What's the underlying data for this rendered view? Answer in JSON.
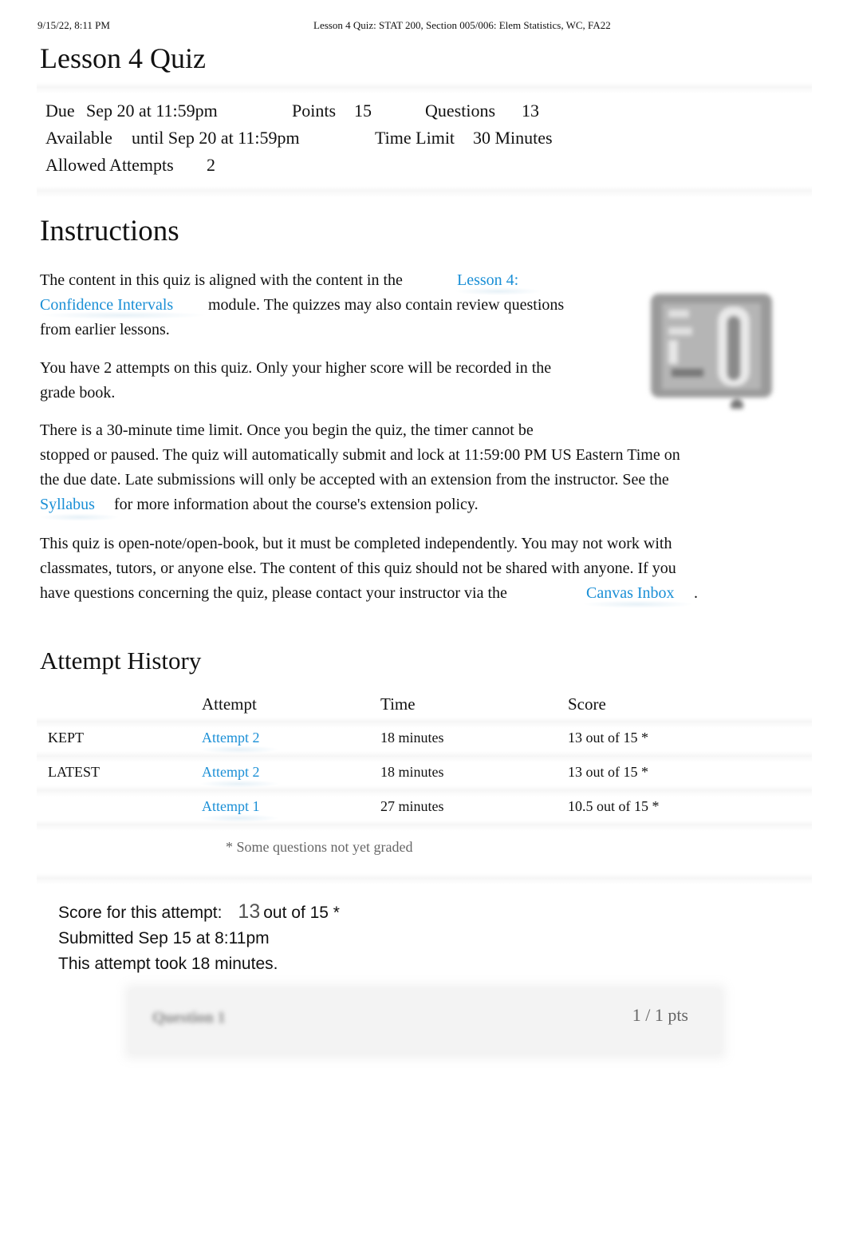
{
  "print_header": {
    "datetime": "9/15/22, 8:11 PM",
    "page_title": "Lesson 4 Quiz: STAT 200, Section 005/006: Elem Statistics, WC, FA22"
  },
  "title": "Lesson 4 Quiz",
  "details": {
    "due_label": "Due",
    "due_value": "Sep 20 at 11:59pm",
    "points_label": "Points",
    "points_value": "15",
    "questions_label": "Questions",
    "questions_value": "13",
    "available_label": "Available",
    "available_value": "until Sep 20 at 11:59pm",
    "time_limit_label": "Time Limit",
    "time_limit_value": "30 Minutes",
    "attempts_label": "Allowed Attempts",
    "attempts_value": "2"
  },
  "instructions": {
    "heading": "Instructions",
    "p1_before": "The content in this quiz is aligned with the content in the",
    "p1_link_line1": "Lesson 4:",
    "p1_link_line2": "Confidence Intervals",
    "p1_after": "module. The quizzes may also contain review questions",
    "p1_end": "from earlier lessons.",
    "p2_line1": "You have 2 attempts on this quiz. Only your higher score will be recorded in the",
    "p2_line2": "grade book.",
    "p3_line1": "There is a 30-minute time limit. Once you begin the quiz, the timer cannot be",
    "p3_line2": "stopped or paused. The quiz will automatically submit and lock at 11:59:00 PM US Eastern Time on",
    "p3_line3": "the due date. Late submissions will only be accepted with an extension from the instructor. See the",
    "p3_link": "Syllabus",
    "p3_line4": "for more information about the course's extension policy.",
    "p4_line1": "This quiz is open-note/open-book, but it must be completed independently. You may not work with",
    "p4_line2": "classmates, tutors, or anyone else. The content of this quiz should not be shared with anyone. If you",
    "p4_line3": "have questions concerning the quiz, please contact your instructor via the",
    "p4_link": "Canvas Inbox",
    "p4_end": ".",
    "image_icon": "book-illustration-icon"
  },
  "attempt_history": {
    "heading": "Attempt History",
    "columns": [
      "",
      "Attempt",
      "Time",
      "Score"
    ],
    "rows": [
      {
        "status": "KEPT",
        "attempt": "Attempt 2",
        "time": "18 minutes",
        "score": "13 out of 15 *"
      },
      {
        "status": "LATEST",
        "attempt": "Attempt 2",
        "time": "18 minutes",
        "score": "13 out of 15 *"
      },
      {
        "status": "",
        "attempt": "Attempt 1",
        "time": "27 minutes",
        "score": "10.5 out of 15 *"
      }
    ],
    "footnote": "* Some questions not yet graded"
  },
  "score_summary": {
    "label": "Score for this attempt:",
    "score": "13",
    "out_of": "out of 15 *",
    "submitted": "Submitted Sep 15 at 8:11pm",
    "duration": "This attempt took 18 minutes."
  },
  "question": {
    "title": "Question 1",
    "points": "1 / 1 pts"
  },
  "colors": {
    "link": "#1a8fd6",
    "text": "#111111",
    "muted": "#666666",
    "card_bg": "#f3f3f3"
  }
}
